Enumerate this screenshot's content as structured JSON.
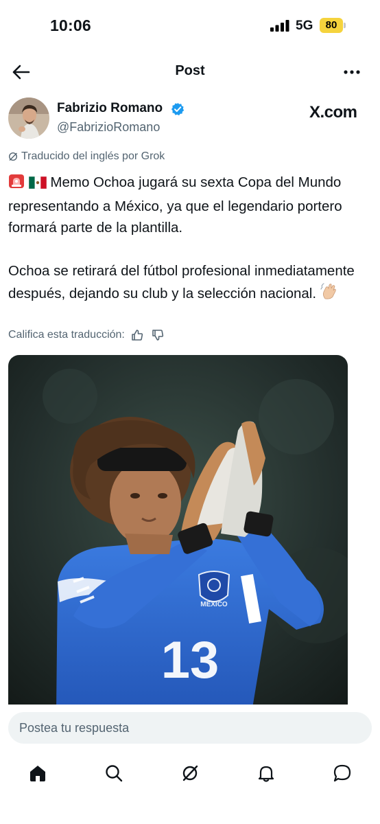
{
  "status_bar": {
    "time": "10:06",
    "network": "5G",
    "battery": "80",
    "battery_color": "#f5d33d"
  },
  "header": {
    "title": "Post",
    "back_icon": "arrow-left-icon",
    "more_icon": "more-horizontal-icon"
  },
  "post": {
    "author_name": "Fabrizio Romano",
    "author_handle": "@FabrizioRomano",
    "verified": true,
    "verified_color": "#1d9bf0",
    "watermark": "X.com",
    "translated_label": "Traducido del inglés por Grok",
    "paragraphs": [
      "Memo Ochoa jugará su sexta Copa del Mundo representando a México, ya que el legendario portero formará parte de la plantilla.",
      "Ochoa se retirará del fútbol profesional inmediatamente después, dejando su club y la selección nacional."
    ],
    "leading_emojis": [
      "siren-emoji",
      "mexico-flag-emoji"
    ],
    "trailing_emoji": "waving-hand-emoji",
    "rate_label": "Califica esta traducción:",
    "media": {
      "jersey_number": "13",
      "badge_text": "MÉXICO",
      "jersey_color": "#2f6fd4"
    }
  },
  "reply": {
    "placeholder": "Postea tu respuesta"
  },
  "tabs": [
    {
      "icon": "home-icon"
    },
    {
      "icon": "search-icon"
    },
    {
      "icon": "grok-icon"
    },
    {
      "icon": "notifications-bell-icon"
    },
    {
      "icon": "messages-icon"
    }
  ]
}
